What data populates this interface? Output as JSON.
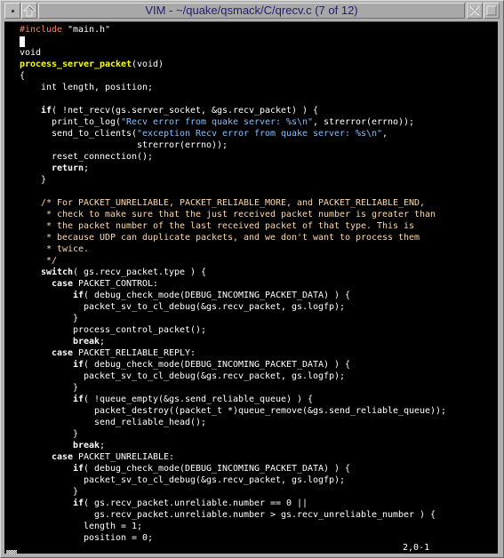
{
  "window": {
    "title": "VIM - ~/quake/qsmack/C/qrecv.c (7 of 12)",
    "buttons": {
      "menu": "window-menu-icon",
      "shade": "shade-arrow-up-icon",
      "close": "close-x-icon",
      "maximize": "maximize-square-icon"
    }
  },
  "colors": {
    "background": "#000000",
    "normal": "#ffffff",
    "preproc": "#ff8060",
    "string": "#80c0ff",
    "comment": "#ffd8a8",
    "function": "#ffff00",
    "keyword": "#ffffff"
  },
  "editor": {
    "cursor_line": 2,
    "ruler": "2,0-1",
    "lines": [
      [
        [
          "preproc",
          "#include"
        ],
        [
          "normal",
          " \"main.h\""
        ]
      ],
      [
        [
          "cursor",
          ""
        ]
      ],
      [
        [
          "normal",
          "void"
        ]
      ],
      [
        [
          "fn",
          "process_server_packet"
        ],
        [
          "normal",
          "(void)"
        ]
      ],
      [
        [
          "normal",
          "{"
        ]
      ],
      [
        [
          "normal",
          "    int length, position;"
        ]
      ],
      [
        [
          "normal",
          ""
        ]
      ],
      [
        [
          "normal",
          "    "
        ],
        [
          "kw",
          "if"
        ],
        [
          "normal",
          "( !net_recv(gs.server_socket, &gs.recv_packet) ) {"
        ]
      ],
      [
        [
          "normal",
          "      print_to_log("
        ],
        [
          "str",
          "\"Recv error from quake server: %s\\n\""
        ],
        [
          "normal",
          ", strerror(errno));"
        ]
      ],
      [
        [
          "normal",
          "      send_to_clients("
        ],
        [
          "str",
          "\"exception Recv error from quake server: %s\\n\""
        ],
        [
          "normal",
          ","
        ]
      ],
      [
        [
          "normal",
          "                      strerror(errno));"
        ]
      ],
      [
        [
          "normal",
          "      reset_connection();"
        ]
      ],
      [
        [
          "normal",
          "      "
        ],
        [
          "kw",
          "return"
        ],
        [
          "normal",
          ";"
        ]
      ],
      [
        [
          "normal",
          "    }"
        ]
      ],
      [
        [
          "normal",
          ""
        ]
      ],
      [
        [
          "normal",
          "    "
        ],
        [
          "cmt",
          "/* For PACKET_UNRELIABLE, PACKET_RELIABLE_MORE, and PACKET_RELIABLE_END,"
        ]
      ],
      [
        [
          "cmt",
          "     * check to make sure that the just received packet number is greater than"
        ]
      ],
      [
        [
          "cmt",
          "     * the packet number of the last received packet of that type. This is"
        ]
      ],
      [
        [
          "cmt",
          "     * because UDP can duplicate packets, and we don't want to process them"
        ]
      ],
      [
        [
          "cmt",
          "     * twice."
        ]
      ],
      [
        [
          "cmt",
          "     */"
        ]
      ],
      [
        [
          "normal",
          "    "
        ],
        [
          "kw",
          "switch"
        ],
        [
          "normal",
          "( gs.recv_packet.type ) {"
        ]
      ],
      [
        [
          "normal",
          "      "
        ],
        [
          "kw",
          "case"
        ],
        [
          "normal",
          " PACKET_CONTROL:"
        ]
      ],
      [
        [
          "normal",
          "          "
        ],
        [
          "kw",
          "if"
        ],
        [
          "normal",
          "( debug_check_mode(DEBUG_INCOMING_PACKET_DATA) ) {"
        ]
      ],
      [
        [
          "normal",
          "            packet_sv_to_cl_debug(&gs.recv_packet, gs.logfp);"
        ]
      ],
      [
        [
          "normal",
          "          }"
        ]
      ],
      [
        [
          "normal",
          "          process_control_packet();"
        ]
      ],
      [
        [
          "normal",
          "          "
        ],
        [
          "kw",
          "break"
        ],
        [
          "normal",
          ";"
        ]
      ],
      [
        [
          "normal",
          "      "
        ],
        [
          "kw",
          "case"
        ],
        [
          "normal",
          " PACKET_RELIABLE_REPLY:"
        ]
      ],
      [
        [
          "normal",
          "          "
        ],
        [
          "kw",
          "if"
        ],
        [
          "normal",
          "( debug_check_mode(DEBUG_INCOMING_PACKET_DATA) ) {"
        ]
      ],
      [
        [
          "normal",
          "            packet_sv_to_cl_debug(&gs.recv_packet, gs.logfp);"
        ]
      ],
      [
        [
          "normal",
          "          }"
        ]
      ],
      [
        [
          "normal",
          "          "
        ],
        [
          "kw",
          "if"
        ],
        [
          "normal",
          "( !queue_empty(&gs.send_reliable_queue) ) {"
        ]
      ],
      [
        [
          "normal",
          "              packet_destroy((packet_t *)queue_remove(&gs.send_reliable_queue));"
        ]
      ],
      [
        [
          "normal",
          "              send_reliable_head();"
        ]
      ],
      [
        [
          "normal",
          "          }"
        ]
      ],
      [
        [
          "normal",
          "          "
        ],
        [
          "kw",
          "break"
        ],
        [
          "normal",
          ";"
        ]
      ],
      [
        [
          "normal",
          "      "
        ],
        [
          "kw",
          "case"
        ],
        [
          "normal",
          " PACKET_UNRELIABLE:"
        ]
      ],
      [
        [
          "normal",
          "          "
        ],
        [
          "kw",
          "if"
        ],
        [
          "normal",
          "( debug_check_mode(DEBUG_INCOMING_PACKET_DATA) ) {"
        ]
      ],
      [
        [
          "normal",
          "            packet_sv_to_cl_debug(&gs.recv_packet, gs.logfp);"
        ]
      ],
      [
        [
          "normal",
          "          }"
        ]
      ],
      [
        [
          "normal",
          "          "
        ],
        [
          "kw",
          "if"
        ],
        [
          "normal",
          "( gs.recv_packet.unreliable.number == 0 ||"
        ]
      ],
      [
        [
          "normal",
          "              gs.recv_packet.unreliable.number > gs.recv_unreliable_number ) {"
        ]
      ],
      [
        [
          "normal",
          "            length = 1;"
        ]
      ],
      [
        [
          "normal",
          "            position = 0;"
        ]
      ]
    ]
  }
}
